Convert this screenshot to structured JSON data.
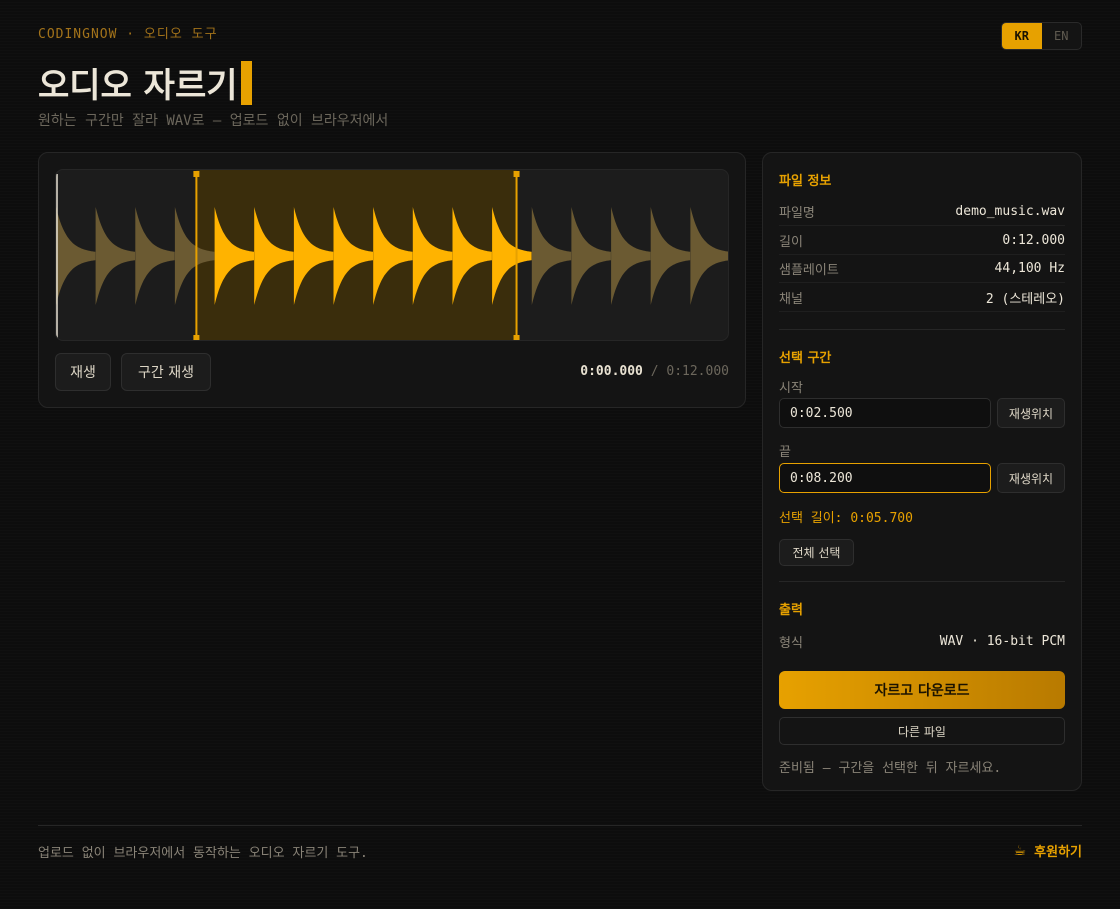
{
  "brand": "CODINGNOW · 오디오 도구",
  "lang": {
    "kr": "KR",
    "en": "EN",
    "active": "KR"
  },
  "title": "오디오 자르기",
  "subtitle": "원하는 구간만 잘라 WAV로 — 업로드 없이 브라우저에서",
  "player": {
    "play_label": "재생",
    "play_range_label": "구간 재생",
    "current_time": "0:00.000",
    "separator": "/",
    "total_time": "0:12.000",
    "selection_start_fraction": 0.2083,
    "selection_end_fraction": 0.6833,
    "playhead_fraction": 0.0,
    "beat_count": 17
  },
  "file_info": {
    "heading": "파일 정보",
    "rows": [
      {
        "key": "파일명",
        "value": "demo_music.wav"
      },
      {
        "key": "길이",
        "value": "0:12.000"
      },
      {
        "key": "샘플레이트",
        "value": "44,100 Hz"
      },
      {
        "key": "채널",
        "value": "2 (스테레오)"
      }
    ]
  },
  "selection": {
    "heading": "선택 구간",
    "start_label": "시작",
    "start_value": "0:02.500",
    "end_label": "끝",
    "end_value": "0:08.200",
    "set_playhead_label": "재생위치",
    "length_text": "선택 길이: 0:05.700",
    "select_all_label": "전체 선택"
  },
  "output": {
    "heading": "출력",
    "format_key": "형식",
    "format_value": "WAV · 16-bit PCM",
    "download_label": "자르고 다운로드",
    "other_file_label": "다른 파일",
    "status": "준비됨 — 구간을 선택한 뒤 자르세요."
  },
  "footer": {
    "text": "업로드 없이 브라우저에서 동작하는 오디오 자르기 도구.",
    "support_icon": "☕",
    "support_label": "후원하기"
  },
  "colors": {
    "accent": "#e7a100",
    "wave_active": "#ffb300",
    "wave_dim": "#6b5a32",
    "selection_fill": "#3a2d0c"
  }
}
